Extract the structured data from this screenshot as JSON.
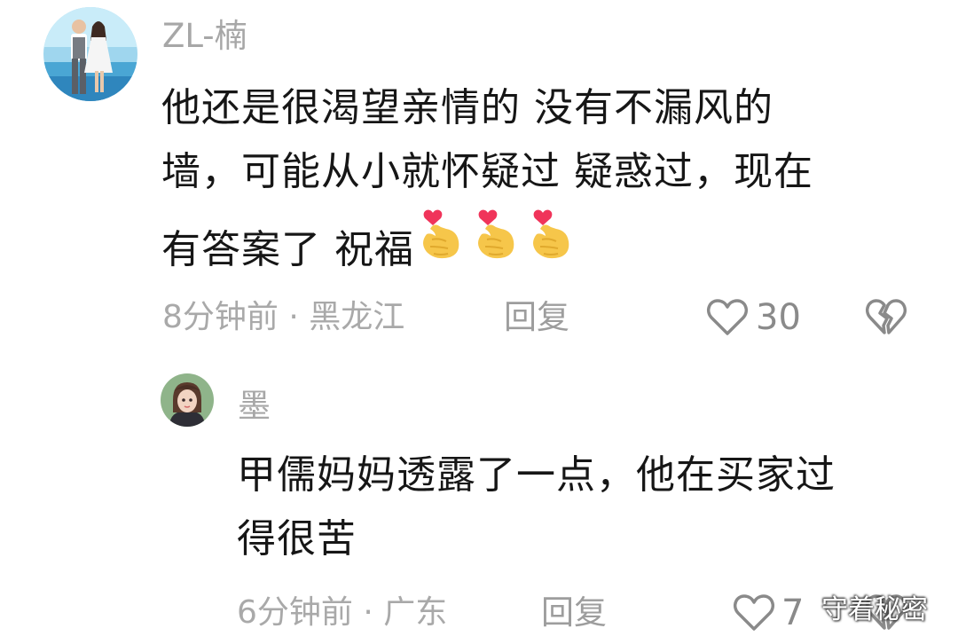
{
  "comments": [
    {
      "username": "ZL-楠",
      "body_line1": "他还是很渴望亲情的  没有不漏风的",
      "body_line2": "墙，可能从小就怀疑过 疑惑过，现在",
      "body_line3": "有答案了  祝福",
      "meta": "8分钟前 · 黑龙江",
      "reply_label": "回复",
      "like_count": "30"
    },
    {
      "username": "墨",
      "body_line1": "甲儒妈妈透露了一点，他在买家过",
      "body_line2": "得很苦",
      "meta": "6分钟前 · 广东",
      "reply_label": "回复",
      "like_count": "7"
    }
  ],
  "watermark": "守着秘密",
  "icons": {
    "like": "heart-outline-icon",
    "dislike": "broken-heart-icon",
    "emoji": "finger-heart-emoji"
  },
  "colors": {
    "text_primary": "#161616",
    "text_secondary": "#a9a9a9",
    "icon": "#8a8a8a",
    "emoji_hand": "#f6c64a",
    "emoji_heart": "#f0345a"
  }
}
